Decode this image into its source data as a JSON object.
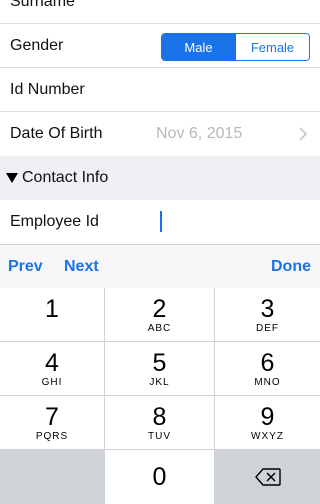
{
  "form": {
    "surname_label": "Surname",
    "gender_label": "Gender",
    "gender_options": [
      "Male",
      "Female"
    ],
    "gender_selected": "Male",
    "id_number_label": "Id Number",
    "dob_label": "Date Of Birth",
    "dob_value": "Nov 6, 2015"
  },
  "section": {
    "title": "Contact Info"
  },
  "employee": {
    "label": "Employee Id",
    "value": ""
  },
  "toolbar": {
    "prev": "Prev",
    "next": "Next",
    "done": "Done"
  },
  "keypad": {
    "keys": [
      {
        "num": "1",
        "letters": ""
      },
      {
        "num": "2",
        "letters": "ABC"
      },
      {
        "num": "3",
        "letters": "DEF"
      },
      {
        "num": "4",
        "letters": "GHI"
      },
      {
        "num": "5",
        "letters": "JKL"
      },
      {
        "num": "6",
        "letters": "MNO"
      },
      {
        "num": "7",
        "letters": "PQRS"
      },
      {
        "num": "8",
        "letters": "TUV"
      },
      {
        "num": "9",
        "letters": "WXYZ"
      },
      {
        "num": "0",
        "letters": ""
      }
    ]
  },
  "colors": {
    "accent": "#1a73e8",
    "section_bg": "#efeff4",
    "keypad_bg": "#cfd3d8"
  }
}
